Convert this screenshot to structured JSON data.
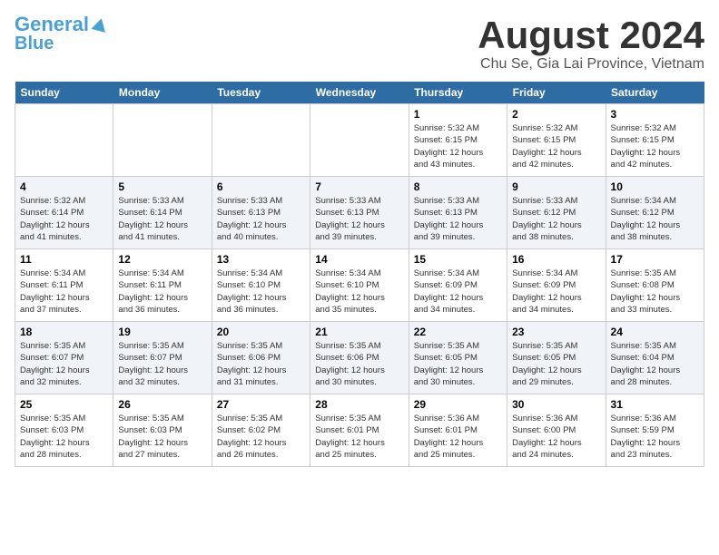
{
  "logo": {
    "line1": "General",
    "line2": "Blue"
  },
  "title": "August 2024",
  "subtitle": "Chu Se, Gia Lai Province, Vietnam",
  "days_of_week": [
    "Sunday",
    "Monday",
    "Tuesday",
    "Wednesday",
    "Thursday",
    "Friday",
    "Saturday"
  ],
  "weeks": [
    [
      {
        "day": "",
        "info": ""
      },
      {
        "day": "",
        "info": ""
      },
      {
        "day": "",
        "info": ""
      },
      {
        "day": "",
        "info": ""
      },
      {
        "day": "1",
        "info": "Sunrise: 5:32 AM\nSunset: 6:15 PM\nDaylight: 12 hours\nand 43 minutes."
      },
      {
        "day": "2",
        "info": "Sunrise: 5:32 AM\nSunset: 6:15 PM\nDaylight: 12 hours\nand 42 minutes."
      },
      {
        "day": "3",
        "info": "Sunrise: 5:32 AM\nSunset: 6:15 PM\nDaylight: 12 hours\nand 42 minutes."
      }
    ],
    [
      {
        "day": "4",
        "info": "Sunrise: 5:32 AM\nSunset: 6:14 PM\nDaylight: 12 hours\nand 41 minutes."
      },
      {
        "day": "5",
        "info": "Sunrise: 5:33 AM\nSunset: 6:14 PM\nDaylight: 12 hours\nand 41 minutes."
      },
      {
        "day": "6",
        "info": "Sunrise: 5:33 AM\nSunset: 6:13 PM\nDaylight: 12 hours\nand 40 minutes."
      },
      {
        "day": "7",
        "info": "Sunrise: 5:33 AM\nSunset: 6:13 PM\nDaylight: 12 hours\nand 39 minutes."
      },
      {
        "day": "8",
        "info": "Sunrise: 5:33 AM\nSunset: 6:13 PM\nDaylight: 12 hours\nand 39 minutes."
      },
      {
        "day": "9",
        "info": "Sunrise: 5:33 AM\nSunset: 6:12 PM\nDaylight: 12 hours\nand 38 minutes."
      },
      {
        "day": "10",
        "info": "Sunrise: 5:34 AM\nSunset: 6:12 PM\nDaylight: 12 hours\nand 38 minutes."
      }
    ],
    [
      {
        "day": "11",
        "info": "Sunrise: 5:34 AM\nSunset: 6:11 PM\nDaylight: 12 hours\nand 37 minutes."
      },
      {
        "day": "12",
        "info": "Sunrise: 5:34 AM\nSunset: 6:11 PM\nDaylight: 12 hours\nand 36 minutes."
      },
      {
        "day": "13",
        "info": "Sunrise: 5:34 AM\nSunset: 6:10 PM\nDaylight: 12 hours\nand 36 minutes."
      },
      {
        "day": "14",
        "info": "Sunrise: 5:34 AM\nSunset: 6:10 PM\nDaylight: 12 hours\nand 35 minutes."
      },
      {
        "day": "15",
        "info": "Sunrise: 5:34 AM\nSunset: 6:09 PM\nDaylight: 12 hours\nand 34 minutes."
      },
      {
        "day": "16",
        "info": "Sunrise: 5:34 AM\nSunset: 6:09 PM\nDaylight: 12 hours\nand 34 minutes."
      },
      {
        "day": "17",
        "info": "Sunrise: 5:35 AM\nSunset: 6:08 PM\nDaylight: 12 hours\nand 33 minutes."
      }
    ],
    [
      {
        "day": "18",
        "info": "Sunrise: 5:35 AM\nSunset: 6:07 PM\nDaylight: 12 hours\nand 32 minutes."
      },
      {
        "day": "19",
        "info": "Sunrise: 5:35 AM\nSunset: 6:07 PM\nDaylight: 12 hours\nand 32 minutes."
      },
      {
        "day": "20",
        "info": "Sunrise: 5:35 AM\nSunset: 6:06 PM\nDaylight: 12 hours\nand 31 minutes."
      },
      {
        "day": "21",
        "info": "Sunrise: 5:35 AM\nSunset: 6:06 PM\nDaylight: 12 hours\nand 30 minutes."
      },
      {
        "day": "22",
        "info": "Sunrise: 5:35 AM\nSunset: 6:05 PM\nDaylight: 12 hours\nand 30 minutes."
      },
      {
        "day": "23",
        "info": "Sunrise: 5:35 AM\nSunset: 6:05 PM\nDaylight: 12 hours\nand 29 minutes."
      },
      {
        "day": "24",
        "info": "Sunrise: 5:35 AM\nSunset: 6:04 PM\nDaylight: 12 hours\nand 28 minutes."
      }
    ],
    [
      {
        "day": "25",
        "info": "Sunrise: 5:35 AM\nSunset: 6:03 PM\nDaylight: 12 hours\nand 28 minutes."
      },
      {
        "day": "26",
        "info": "Sunrise: 5:35 AM\nSunset: 6:03 PM\nDaylight: 12 hours\nand 27 minutes."
      },
      {
        "day": "27",
        "info": "Sunrise: 5:35 AM\nSunset: 6:02 PM\nDaylight: 12 hours\nand 26 minutes."
      },
      {
        "day": "28",
        "info": "Sunrise: 5:35 AM\nSunset: 6:01 PM\nDaylight: 12 hours\nand 25 minutes."
      },
      {
        "day": "29",
        "info": "Sunrise: 5:36 AM\nSunset: 6:01 PM\nDaylight: 12 hours\nand 25 minutes."
      },
      {
        "day": "30",
        "info": "Sunrise: 5:36 AM\nSunset: 6:00 PM\nDaylight: 12 hours\nand 24 minutes."
      },
      {
        "day": "31",
        "info": "Sunrise: 5:36 AM\nSunset: 5:59 PM\nDaylight: 12 hours\nand 23 minutes."
      }
    ]
  ]
}
